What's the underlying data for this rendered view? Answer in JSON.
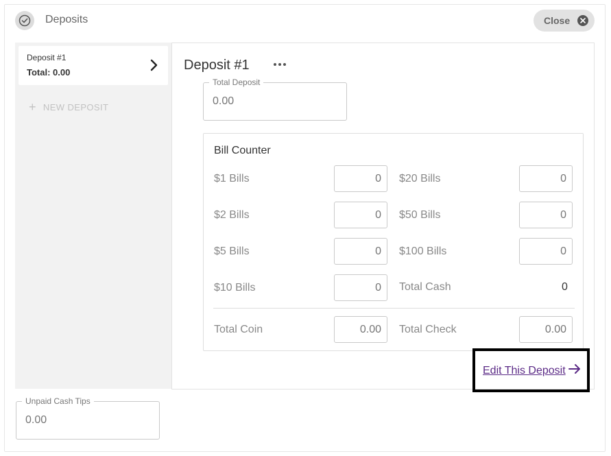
{
  "header": {
    "title": "Deposits",
    "close_label": "Close"
  },
  "sidebar": {
    "deposit": {
      "name": "Deposit #1",
      "total": "Total: 0.00"
    },
    "new_deposit_label": "NEW DEPOSIT"
  },
  "main": {
    "title": "Deposit #1",
    "total_deposit": {
      "label": "Total Deposit",
      "placeholder": "0.00"
    },
    "bill_counter": {
      "title": "Bill Counter",
      "bills": {
        "b1": {
          "label": "$1 Bills",
          "placeholder": "0"
        },
        "b2": {
          "label": "$2 Bills",
          "placeholder": "0"
        },
        "b5": {
          "label": "$5 Bills",
          "placeholder": "0"
        },
        "b10": {
          "label": "$10 Bills",
          "placeholder": "0"
        },
        "b20": {
          "label": "$20 Bills",
          "placeholder": "0"
        },
        "b50": {
          "label": "$50 Bills",
          "placeholder": "0"
        },
        "b100": {
          "label": "$100 Bills",
          "placeholder": "0"
        }
      },
      "total_cash": {
        "label": "Total Cash",
        "value": "0"
      },
      "total_coin": {
        "label": "Total Coin",
        "placeholder": "0.00"
      },
      "total_check": {
        "label": "Total Check",
        "placeholder": "0.00"
      }
    },
    "edit_link_label": "Edit This Deposit"
  },
  "unpaid_tips": {
    "label": "Unpaid Cash Tips",
    "placeholder": "0.00"
  },
  "colors": {
    "link": "#5b2a86",
    "sidebar_bg": "#f2f2f2",
    "close_bg": "#e2e2e2"
  },
  "icons": [
    "check-circle-icon",
    "close-x-icon",
    "chevron-right-icon",
    "plus-icon",
    "more-horizontal-icon",
    "arrow-right-icon"
  ]
}
